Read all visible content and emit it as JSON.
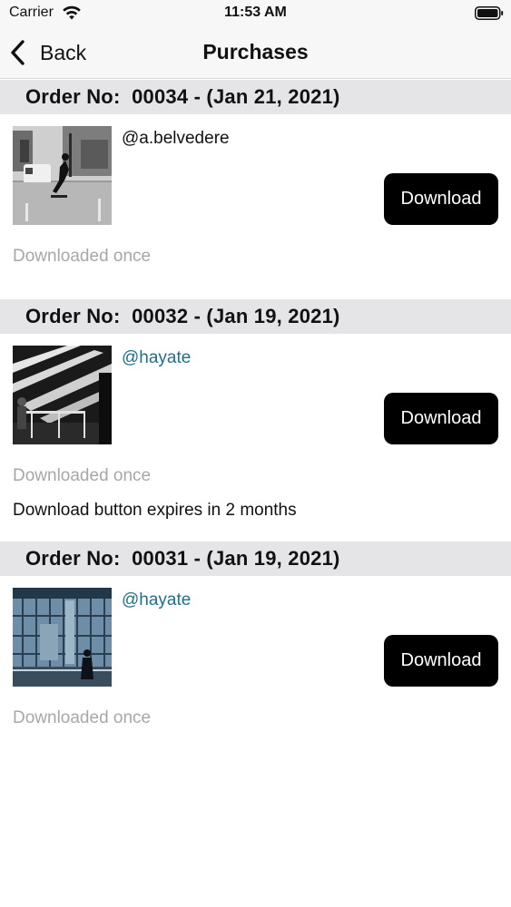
{
  "status_bar": {
    "carrier": "Carrier",
    "time": "11:53 AM",
    "icons": [
      "wifi-icon",
      "battery-icon"
    ]
  },
  "nav": {
    "back_label": "Back",
    "back_icon": "chevron-left-icon",
    "title": "Purchases"
  },
  "orders": [
    {
      "header": "Order No:  00034 - (Jan 21, 2021)",
      "username": "@a.belvedere",
      "username_style": "plain",
      "download_label": "Download",
      "download_status": "Downloaded once",
      "expiry_note": "",
      "thumbnail": "street-skater-photo"
    },
    {
      "header": "Order No:  00032 - (Jan 19, 2021)",
      "username": "@hayate",
      "username_style": "link",
      "download_label": "Download",
      "download_status": "Downloaded once",
      "expiry_note": "Download button expires in 2 months",
      "thumbnail": "stairway-shadow-photo"
    },
    {
      "header": "Order No:  00031 - (Jan 19, 2021)",
      "username": "@hayate",
      "username_style": "link",
      "download_label": "Download",
      "download_status": "Downloaded once",
      "expiry_note": "",
      "thumbnail": "glass-building-figure-photo"
    }
  ],
  "colors": {
    "section_header_bg": "#e5e5e7",
    "link": "#1f6f8b",
    "muted_text": "#a7a7a7",
    "button_bg": "#000000"
  }
}
